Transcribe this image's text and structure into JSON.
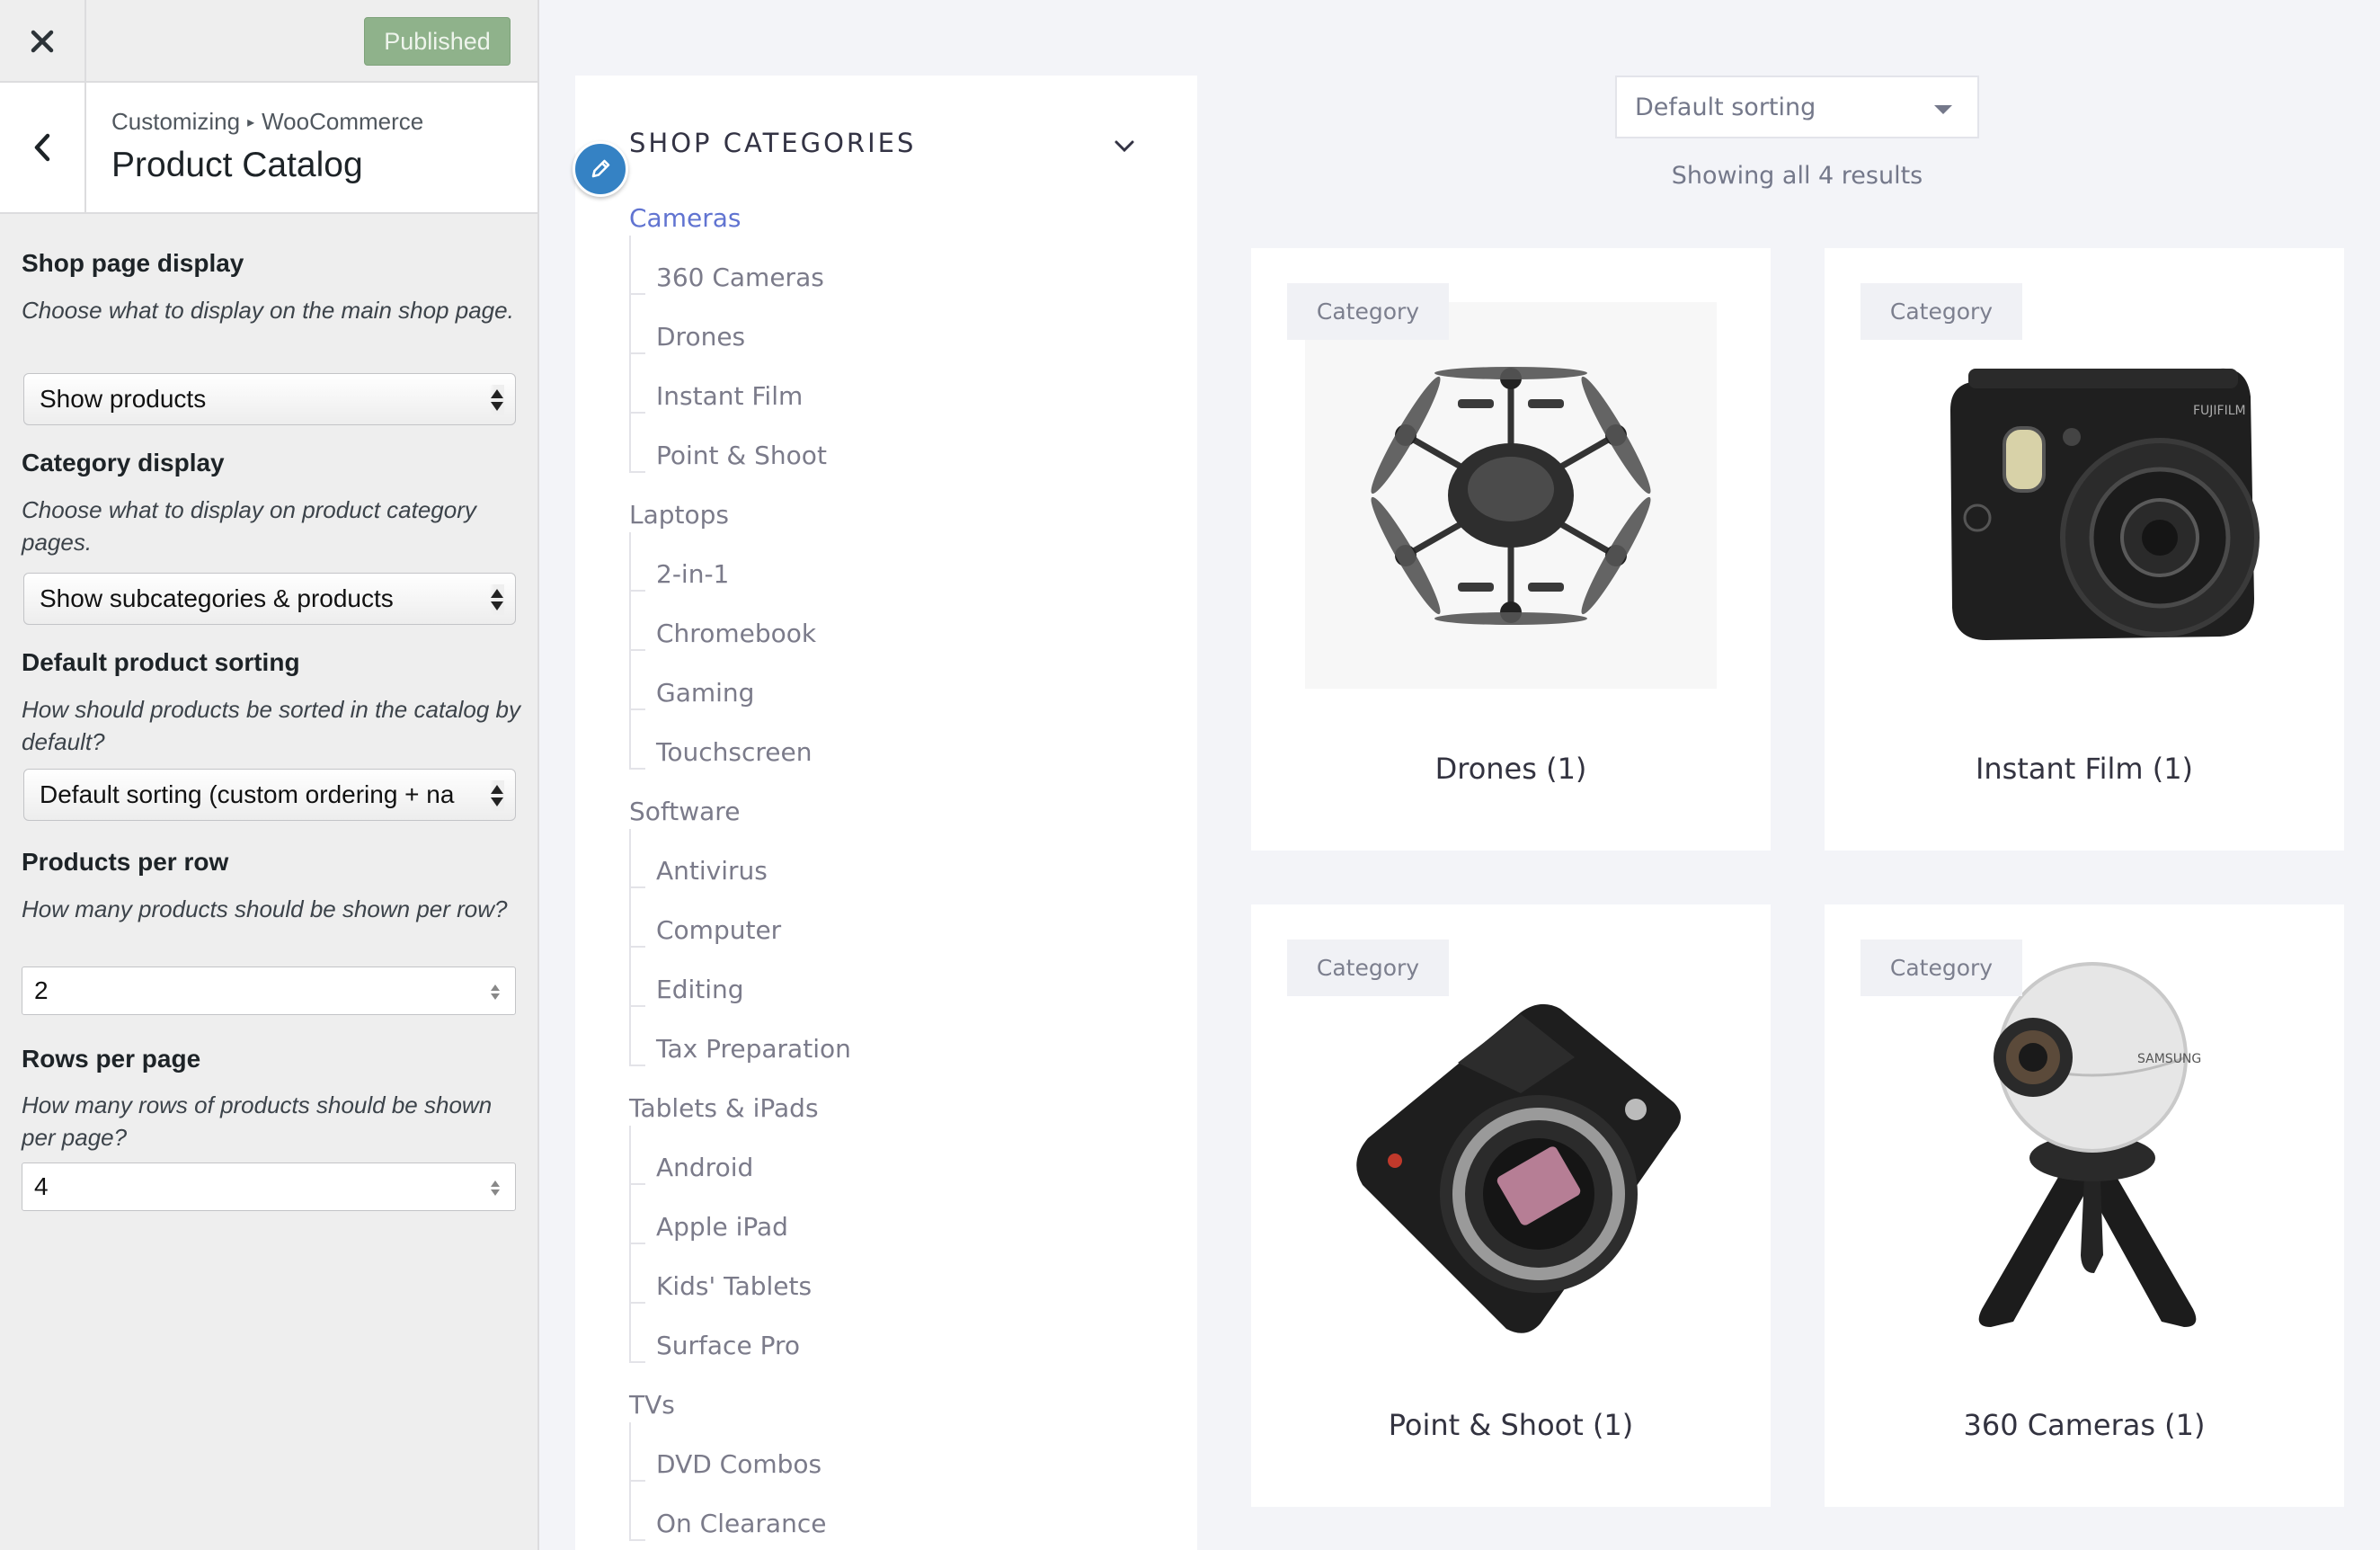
{
  "customizer": {
    "publish_label": "Published",
    "breadcrumb": {
      "root": "Customizing",
      "separator": "▸",
      "parent": "WooCommerce"
    },
    "section_title": "Product Catalog",
    "controls": [
      {
        "label": "Shop page display",
        "description": "Choose what to display on the main shop page.",
        "value": "Show products"
      },
      {
        "label": "Category display",
        "description": "Choose what to display on product category pages.",
        "value": "Show subcategories & products"
      },
      {
        "label": "Default product sorting",
        "description": "How should products be sorted in the catalog by default?",
        "value": "Default sorting (custom ordering + na"
      },
      {
        "label": "Products per row",
        "description": "How many products should be shown per row?",
        "value": "2"
      },
      {
        "label": "Rows per page",
        "description": "How many rows of products should be shown per page?",
        "value": "4"
      }
    ]
  },
  "shop_categories": {
    "title": "SHOP CATEGORIES",
    "groups": [
      {
        "name": "Cameras",
        "active": true,
        "children": [
          "360 Cameras",
          "Drones",
          "Instant Film",
          "Point & Shoot"
        ]
      },
      {
        "name": "Laptops",
        "children": [
          "2-in-1",
          "Chromebook",
          "Gaming",
          "Touchscreen"
        ]
      },
      {
        "name": "Software",
        "children": [
          "Antivirus",
          "Computer",
          "Editing",
          "Tax Preparation"
        ]
      },
      {
        "name": "Tablets & iPads",
        "children": [
          "Android",
          "Apple iPad",
          "Kids' Tablets",
          "Surface Pro"
        ]
      },
      {
        "name": "TVs",
        "children": [
          "DVD Combos",
          "On Clearance"
        ]
      }
    ]
  },
  "shop": {
    "sorting": "Default sorting",
    "result_count": "Showing all 4 results",
    "cards": [
      {
        "badge": "Category",
        "title": "Drones  (1)",
        "image": "drone"
      },
      {
        "badge": "Category",
        "title": "Instant Film  (1)",
        "image": "instant-camera"
      },
      {
        "badge": "Category",
        "title": "Point & Shoot  (1)",
        "image": "mirrorless-camera"
      },
      {
        "badge": "Category",
        "title": "360 Cameras  (1)",
        "image": "360-camera"
      }
    ]
  },
  "colors": {
    "accent": "#6174d1",
    "published": "#8fb28b",
    "shortcut": "#3582c4"
  }
}
